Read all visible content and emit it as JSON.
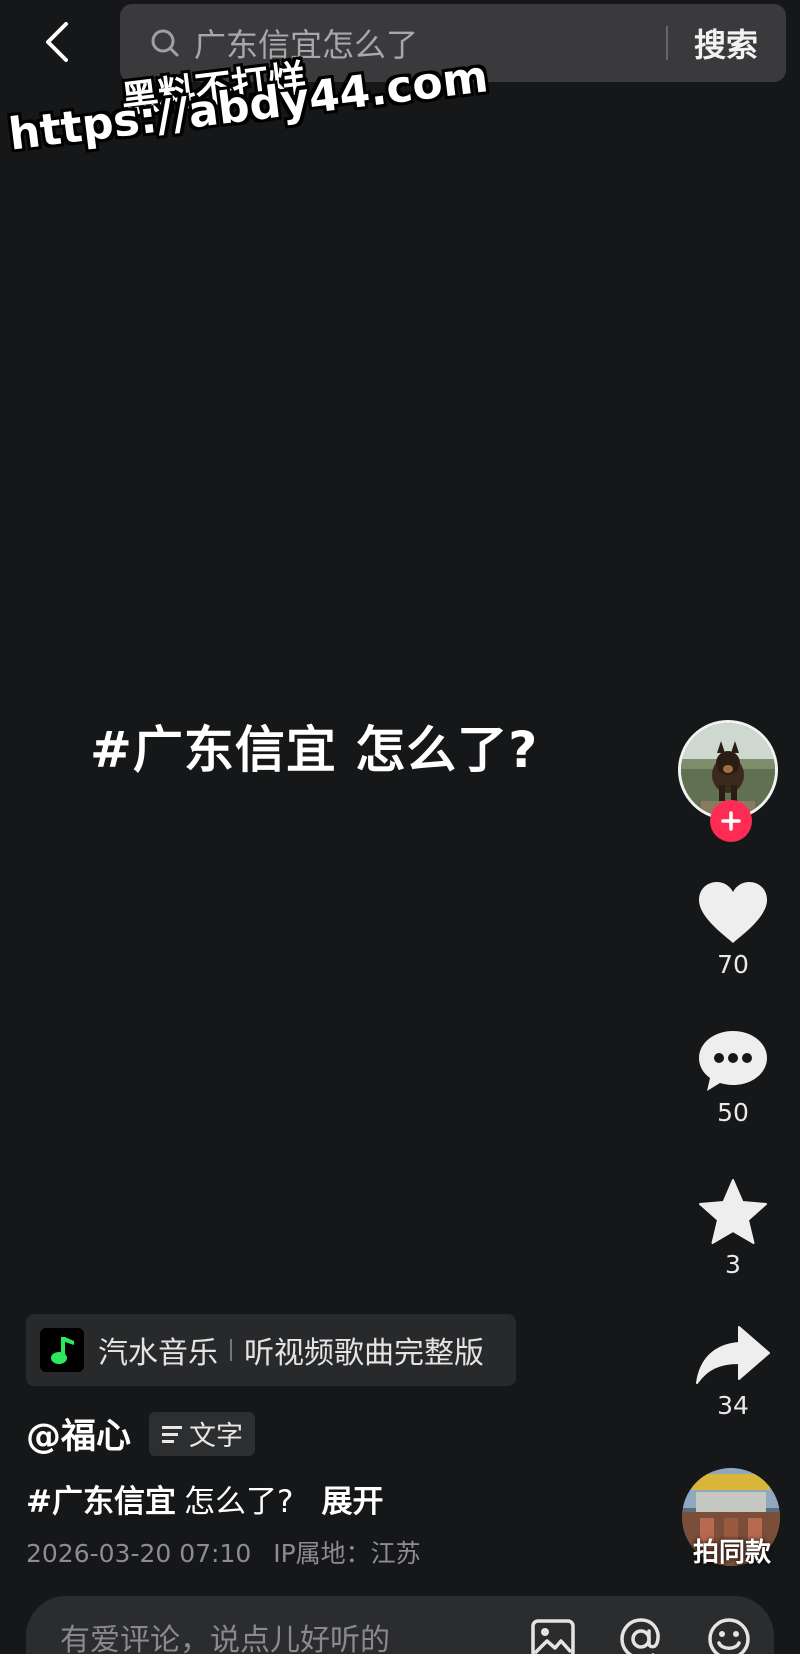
{
  "search": {
    "query": "广东信宜怎么了",
    "button_label": "搜索"
  },
  "watermark": {
    "line1": "黑料不打烊",
    "line2": "https://abdy44.com"
  },
  "video": {
    "caption": "#广东信宜 怎么了?"
  },
  "actions": {
    "likes": "70",
    "comments": "50",
    "favorites": "3",
    "shares": "34"
  },
  "music": {
    "app_name": "汽水音乐",
    "description": "听视频歌曲完整版"
  },
  "post": {
    "author": "@福心",
    "text_tag_label": "文字",
    "hashtag": "#广东信宜",
    "description": "怎么了?",
    "expand_label": "展开",
    "timestamp": "2026-03-20 07:10",
    "ip_location": "IP属地：江苏"
  },
  "same_style": {
    "label": "拍同款"
  },
  "comment_bar": {
    "placeholder": "有爱评论，说点儿好听的"
  },
  "icons": {
    "back": "chevron-left-icon",
    "search": "search-icon",
    "like": "heart-icon",
    "comment": "chat-bubble-icon",
    "favorite": "star-icon",
    "share": "share-arrow-icon",
    "follow": "plus-icon",
    "text_tag": "lines-icon",
    "image": "image-icon",
    "mention": "at-icon",
    "emoji": "emoji-icon"
  },
  "colors": {
    "background": "#161718",
    "follow_accent": "#fe2c55",
    "search_bar": "#3a3a3c",
    "music_logo_green": "#2ee85c"
  }
}
